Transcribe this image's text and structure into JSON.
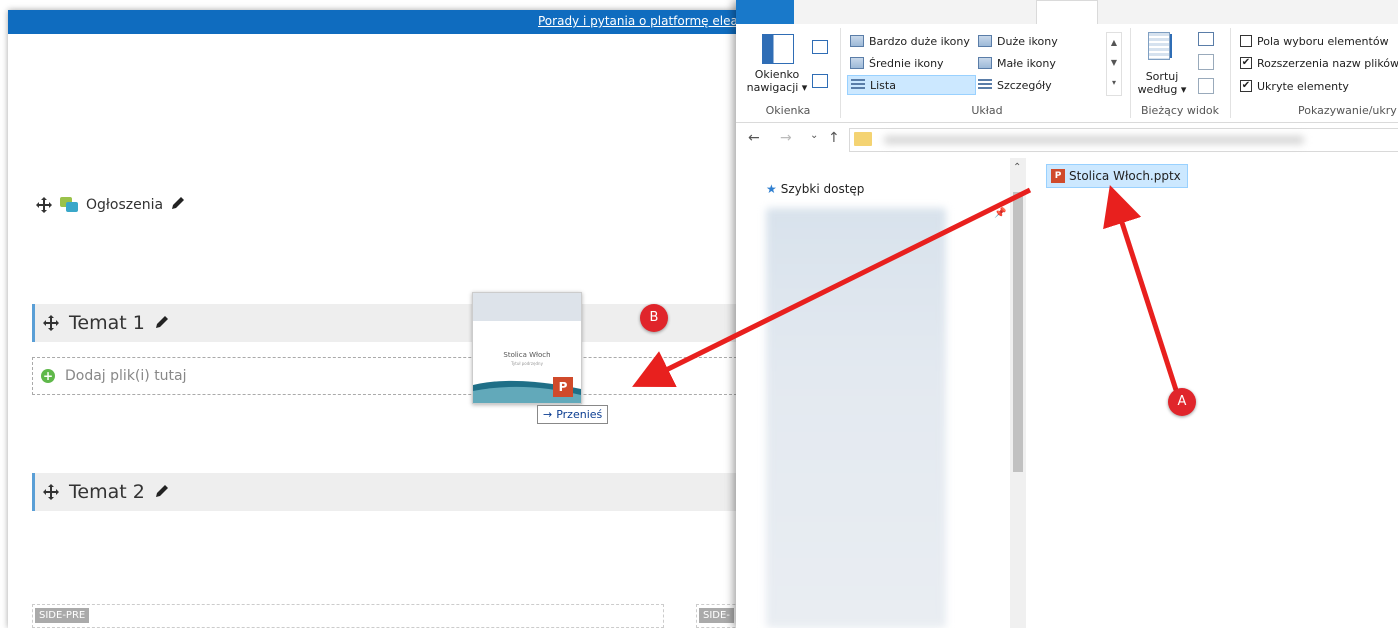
{
  "moodle": {
    "top_link": "Porady i pytania o platformę elea",
    "announcements": "Ogłoszenia",
    "section1": "Temat 1",
    "dropzone": "Dodaj plik(i) tutaj",
    "section2": "Temat 2",
    "block_left": "SIDE-PRE",
    "block_right": "SIDE-"
  },
  "drag": {
    "thumb_title": "Stolica Włoch",
    "thumb_sub": "Tytuł podrzędny",
    "tooltip": "Przenieś",
    "ppt_letter": "P"
  },
  "badges": {
    "a": "A",
    "b": "B"
  },
  "explorer": {
    "ribbon": {
      "nav_pane": "Okienko\nnawigacji",
      "nav_pane_line1": "Okienko",
      "nav_pane_line2": "nawigacji ▾",
      "group_panes": "Okienka",
      "layout_items": [
        "Bardzo duże ikony",
        "Duże ikony",
        "Średnie ikony",
        "Małe ikony",
        "Lista",
        "Szczegóły"
      ],
      "group_layout": "Układ",
      "sort_line1": "Sortuj",
      "sort_line2": "według ▾",
      "group_view": "Bieżący widok",
      "show_items": [
        "Pola wyboru elementów",
        "Rozszerzenia nazw plików",
        "Ukryte elementy"
      ],
      "show_checked": [
        false,
        true,
        true
      ],
      "group_show": "Pokazywanie/ukry"
    },
    "quick_access": "Szybki dostęp",
    "file_name": "Stolica Włoch.pptx"
  },
  "colors": {
    "moodle_blue": "#0f6cbf",
    "badge_red": "#e0252b",
    "arrow_red": "#e8201e",
    "selected": "#cce8ff"
  }
}
